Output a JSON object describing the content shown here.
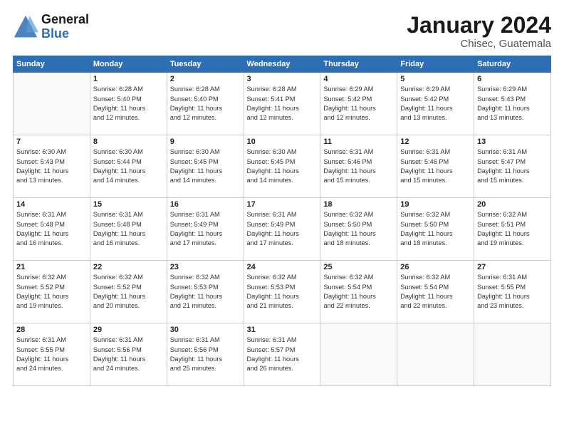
{
  "logo": {
    "general": "General",
    "blue": "Blue"
  },
  "title": "January 2024",
  "location": "Chisec, Guatemala",
  "days_header": [
    "Sunday",
    "Monday",
    "Tuesday",
    "Wednesday",
    "Thursday",
    "Friday",
    "Saturday"
  ],
  "weeks": [
    [
      {
        "num": "",
        "empty": true
      },
      {
        "num": "1",
        "sunrise": "6:28 AM",
        "sunset": "5:40 PM",
        "daylight": "11 hours and 12 minutes."
      },
      {
        "num": "2",
        "sunrise": "6:28 AM",
        "sunset": "5:40 PM",
        "daylight": "11 hours and 12 minutes."
      },
      {
        "num": "3",
        "sunrise": "6:28 AM",
        "sunset": "5:41 PM",
        "daylight": "11 hours and 12 minutes."
      },
      {
        "num": "4",
        "sunrise": "6:29 AM",
        "sunset": "5:42 PM",
        "daylight": "11 hours and 12 minutes."
      },
      {
        "num": "5",
        "sunrise": "6:29 AM",
        "sunset": "5:42 PM",
        "daylight": "11 hours and 13 minutes."
      },
      {
        "num": "6",
        "sunrise": "6:29 AM",
        "sunset": "5:43 PM",
        "daylight": "11 hours and 13 minutes."
      }
    ],
    [
      {
        "num": "7",
        "sunrise": "6:30 AM",
        "sunset": "5:43 PM",
        "daylight": "11 hours and 13 minutes."
      },
      {
        "num": "8",
        "sunrise": "6:30 AM",
        "sunset": "5:44 PM",
        "daylight": "11 hours and 14 minutes."
      },
      {
        "num": "9",
        "sunrise": "6:30 AM",
        "sunset": "5:45 PM",
        "daylight": "11 hours and 14 minutes."
      },
      {
        "num": "10",
        "sunrise": "6:30 AM",
        "sunset": "5:45 PM",
        "daylight": "11 hours and 14 minutes."
      },
      {
        "num": "11",
        "sunrise": "6:31 AM",
        "sunset": "5:46 PM",
        "daylight": "11 hours and 15 minutes."
      },
      {
        "num": "12",
        "sunrise": "6:31 AM",
        "sunset": "5:46 PM",
        "daylight": "11 hours and 15 minutes."
      },
      {
        "num": "13",
        "sunrise": "6:31 AM",
        "sunset": "5:47 PM",
        "daylight": "11 hours and 15 minutes."
      }
    ],
    [
      {
        "num": "14",
        "sunrise": "6:31 AM",
        "sunset": "5:48 PM",
        "daylight": "11 hours and 16 minutes."
      },
      {
        "num": "15",
        "sunrise": "6:31 AM",
        "sunset": "5:48 PM",
        "daylight": "11 hours and 16 minutes."
      },
      {
        "num": "16",
        "sunrise": "6:31 AM",
        "sunset": "5:49 PM",
        "daylight": "11 hours and 17 minutes."
      },
      {
        "num": "17",
        "sunrise": "6:31 AM",
        "sunset": "5:49 PM",
        "daylight": "11 hours and 17 minutes."
      },
      {
        "num": "18",
        "sunrise": "6:32 AM",
        "sunset": "5:50 PM",
        "daylight": "11 hours and 18 minutes."
      },
      {
        "num": "19",
        "sunrise": "6:32 AM",
        "sunset": "5:50 PM",
        "daylight": "11 hours and 18 minutes."
      },
      {
        "num": "20",
        "sunrise": "6:32 AM",
        "sunset": "5:51 PM",
        "daylight": "11 hours and 19 minutes."
      }
    ],
    [
      {
        "num": "21",
        "sunrise": "6:32 AM",
        "sunset": "5:52 PM",
        "daylight": "11 hours and 19 minutes."
      },
      {
        "num": "22",
        "sunrise": "6:32 AM",
        "sunset": "5:52 PM",
        "daylight": "11 hours and 20 minutes."
      },
      {
        "num": "23",
        "sunrise": "6:32 AM",
        "sunset": "5:53 PM",
        "daylight": "11 hours and 21 minutes."
      },
      {
        "num": "24",
        "sunrise": "6:32 AM",
        "sunset": "5:53 PM",
        "daylight": "11 hours and 21 minutes."
      },
      {
        "num": "25",
        "sunrise": "6:32 AM",
        "sunset": "5:54 PM",
        "daylight": "11 hours and 22 minutes."
      },
      {
        "num": "26",
        "sunrise": "6:32 AM",
        "sunset": "5:54 PM",
        "daylight": "11 hours and 22 minutes."
      },
      {
        "num": "27",
        "sunrise": "6:31 AM",
        "sunset": "5:55 PM",
        "daylight": "11 hours and 23 minutes."
      }
    ],
    [
      {
        "num": "28",
        "sunrise": "6:31 AM",
        "sunset": "5:55 PM",
        "daylight": "11 hours and 24 minutes."
      },
      {
        "num": "29",
        "sunrise": "6:31 AM",
        "sunset": "5:56 PM",
        "daylight": "11 hours and 24 minutes."
      },
      {
        "num": "30",
        "sunrise": "6:31 AM",
        "sunset": "5:56 PM",
        "daylight": "11 hours and 25 minutes."
      },
      {
        "num": "31",
        "sunrise": "6:31 AM",
        "sunset": "5:57 PM",
        "daylight": "11 hours and 26 minutes."
      },
      {
        "num": "",
        "empty": true
      },
      {
        "num": "",
        "empty": true
      },
      {
        "num": "",
        "empty": true
      }
    ]
  ]
}
